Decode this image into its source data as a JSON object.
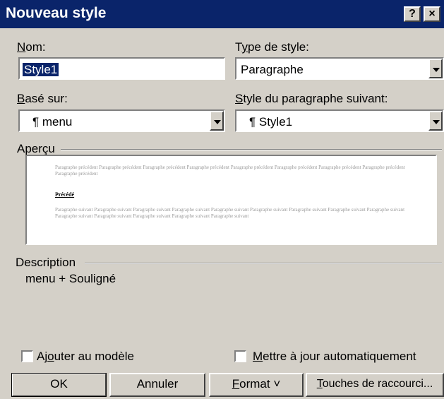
{
  "dialog": {
    "title": "Nouveau style",
    "help_label": "?",
    "close_label": "×"
  },
  "name": {
    "label_key": "N",
    "label_rest": "om:",
    "value": "Style1"
  },
  "style_type": {
    "label_pre": "T",
    "label_key": "y",
    "label_rest": "pe de style:",
    "value": "Paragraphe"
  },
  "based_on": {
    "label_key": "B",
    "label_rest": "asé sur:",
    "value": "¶ menu"
  },
  "next_style": {
    "label_key": "S",
    "label_rest": "tyle du paragraphe suivant:",
    "value": "¶ Style1"
  },
  "preview": {
    "label": "Aperçu",
    "prev_text": "Paragraphe précédent Paragraphe précédent Paragraphe précédent Paragraphe précédent Paragraphe précédent Paragraphe précédent Paragraphe précédent Paragraphe précédent Paragraphe précédent",
    "current_text": "Précédé",
    "next_text": "Paragraphe suivant Paragraphe suivant Paragraphe suivant Paragraphe suivant Paragraphe suivant Paragraphe suivant Paragraphe suivant Paragraphe suivant Paragraphe suivant Paragraphe suivant Paragraphe suivant Paragraphe suivant Paragraphe suivant Paragraphe suivant"
  },
  "description": {
    "label": "Description",
    "value": "menu + Souligné"
  },
  "add_to_template": {
    "label_pre": "Aj",
    "label_key": "o",
    "label_rest": "uter au modèle",
    "checked": false
  },
  "auto_update": {
    "label_key": "M",
    "label_rest": "ettre à jour automatiquement",
    "checked": false
  },
  "buttons": {
    "ok": "OK",
    "cancel": "Annuler",
    "format_key": "F",
    "format_rest": "ormat ˅",
    "shortcut_key": "T",
    "shortcut_rest": "ouches de raccourci..."
  }
}
